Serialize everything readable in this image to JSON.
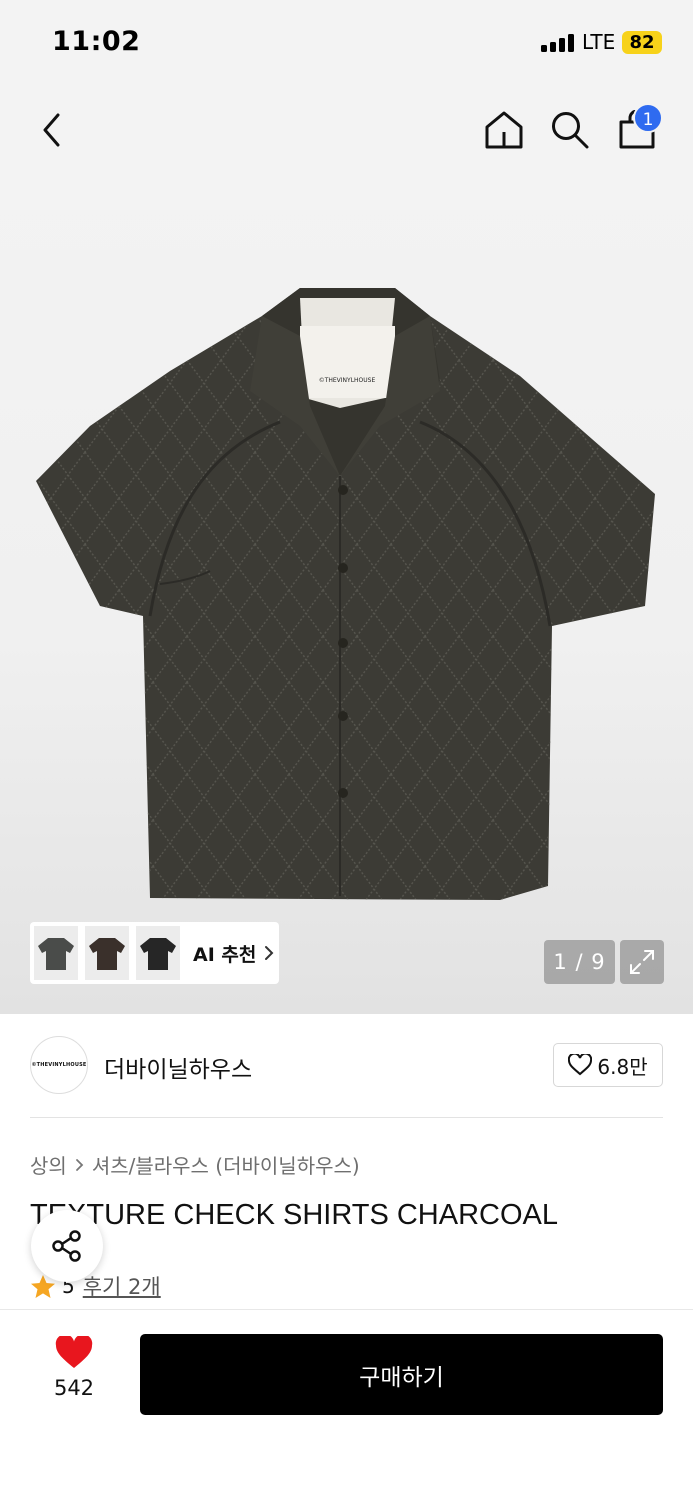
{
  "status_bar": {
    "time": "11:02",
    "network": "LTE",
    "battery": "82"
  },
  "nav": {
    "back_icon": "chevron-left-icon",
    "home_icon": "home-icon",
    "search_icon": "search-icon",
    "cart_icon": "shopping-bag-icon",
    "cart_count": "1"
  },
  "gallery": {
    "current": "1 / 9",
    "ai_label": "AI 추천",
    "thumb_colors": [
      "#4a4c4a",
      "#3a302b",
      "#262626"
    ],
    "shirt_color": "#3c3b35"
  },
  "brand": {
    "logo_text": "©THEVINYLHOUSE",
    "name": "더바이닐하우스",
    "likes": "6.8만"
  },
  "breadcrumb": {
    "level1": "상의",
    "level2": "셔츠/블라우스 (더바이닐하우스)"
  },
  "product": {
    "title": "TEXTURE CHECK SHIRTS CHARCOAL",
    "rating": "5",
    "reviews": "후기 2개"
  },
  "bottom": {
    "wish_count": "542",
    "buy_label": "구매하기",
    "heart_color": "#e8161e"
  },
  "label_tag": "©THEVINYLHOUSE"
}
